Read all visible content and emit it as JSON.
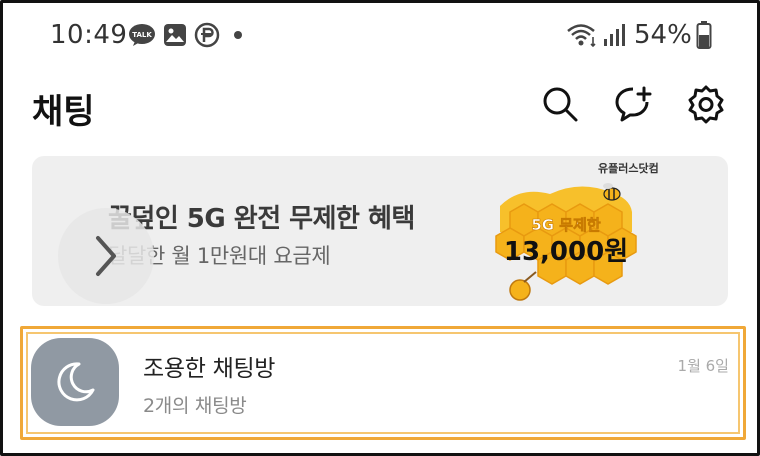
{
  "status_bar": {
    "time": "10:49",
    "battery_percent": "54%",
    "notification_icons": [
      "kakaotalk-talk-icon",
      "gallery-icon",
      "pay-icon",
      "more-dot"
    ],
    "system_icons": [
      "wifi-icon",
      "signal-icon",
      "battery-icon"
    ]
  },
  "header": {
    "title": "채팅",
    "actions": [
      "search-icon",
      "new-chat-icon",
      "settings-icon"
    ]
  },
  "banner": {
    "title": "꿀덮인 5G 완전 무제한 혜택",
    "subtitle": "달달한 월 1만원대 요금제",
    "brand": "유플러스닷컴",
    "badge_line1": "5G 무제한",
    "badge_line2": "13,000원",
    "accent_color": "#f5b21b"
  },
  "chat_list": [
    {
      "name": "조용한 채팅방",
      "preview": "2개의 채팅방",
      "date": "1월 6일",
      "avatar_icon": "moon-icon",
      "avatar_color": "#9099a3"
    }
  ],
  "highlight_color": "#f0a838"
}
